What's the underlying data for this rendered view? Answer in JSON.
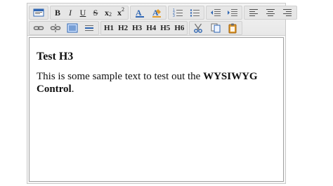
{
  "toolbar": {
    "row1": {
      "bold_label": "B",
      "italic_label": "I",
      "underline_label": "U",
      "strike_label": "S",
      "subscript_base": "x",
      "subscript_small": "2",
      "superscript_base": "x",
      "superscript_small": "2"
    },
    "row2": {
      "h1": "H1",
      "h2": "H2",
      "h3": "H3",
      "h4": "H4",
      "h5": "H5",
      "h6": "H6"
    }
  },
  "content": {
    "heading": "Test H3",
    "paragraph_text": "This is some sample text to test out the ",
    "paragraph_strong": "WYSIWYG Control",
    "paragraph_end": "."
  },
  "colors": {
    "icon_blue": "#2f66b3",
    "icon_orange": "#e09b2d",
    "icon_gray": "#6b6b6b"
  }
}
